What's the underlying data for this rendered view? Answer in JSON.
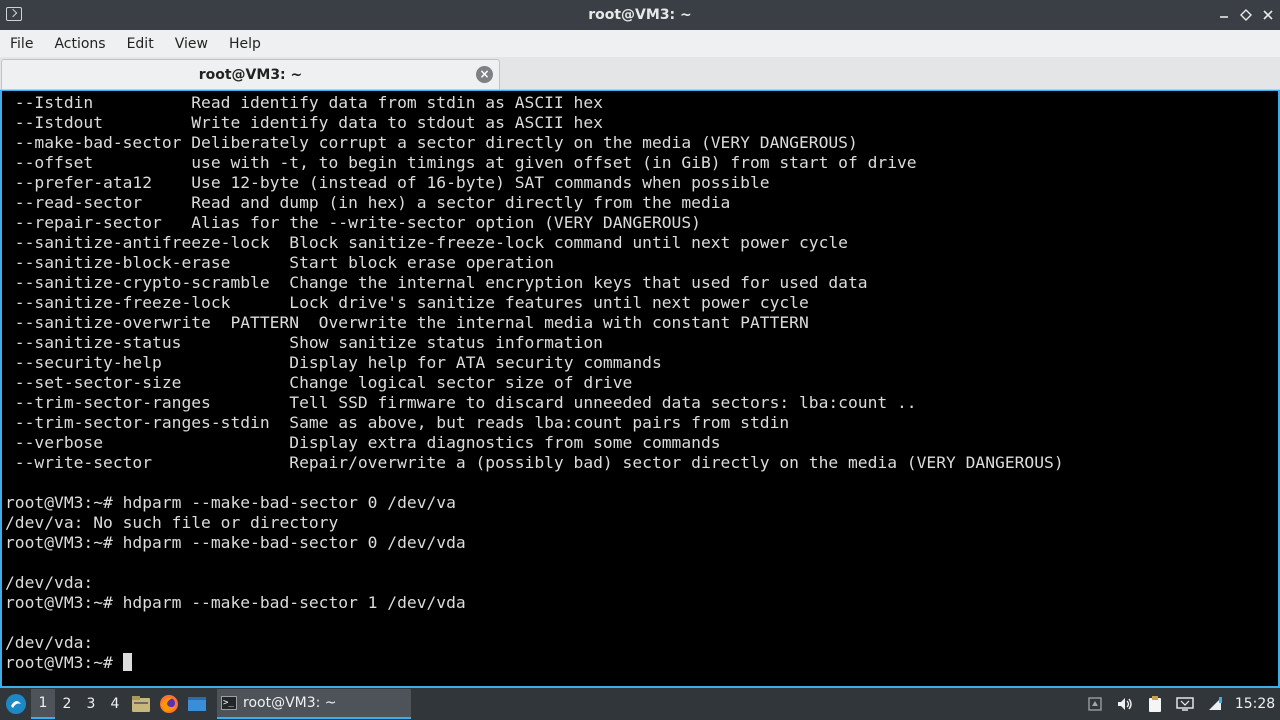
{
  "window": {
    "title": "root@VM3: ~",
    "controls": [
      "minimize-icon",
      "maximize-icon",
      "close-icon"
    ]
  },
  "menu": [
    "File",
    "Actions",
    "Edit",
    "View",
    "Help"
  ],
  "tab": {
    "label": "root@VM3: ~"
  },
  "terminal": {
    "lines": [
      " --Istdin          Read identify data from stdin as ASCII hex",
      " --Istdout         Write identify data to stdout as ASCII hex",
      " --make-bad-sector Deliberately corrupt a sector directly on the media (VERY DANGEROUS)",
      " --offset          use with -t, to begin timings at given offset (in GiB) from start of drive",
      " --prefer-ata12    Use 12-byte (instead of 16-byte) SAT commands when possible",
      " --read-sector     Read and dump (in hex) a sector directly from the media",
      " --repair-sector   Alias for the --write-sector option (VERY DANGEROUS)",
      " --sanitize-antifreeze-lock  Block sanitize-freeze-lock command until next power cycle",
      " --sanitize-block-erase      Start block erase operation",
      " --sanitize-crypto-scramble  Change the internal encryption keys that used for used data",
      " --sanitize-freeze-lock      Lock drive's sanitize features until next power cycle",
      " --sanitize-overwrite  PATTERN  Overwrite the internal media with constant PATTERN",
      " --sanitize-status           Show sanitize status information",
      " --security-help             Display help for ATA security commands",
      " --set-sector-size           Change logical sector size of drive",
      " --trim-sector-ranges        Tell SSD firmware to discard unneeded data sectors: lba:count ..",
      " --trim-sector-ranges-stdin  Same as above, but reads lba:count pairs from stdin",
      " --verbose                   Display extra diagnostics from some commands",
      " --write-sector              Repair/overwrite a (possibly bad) sector directly on the media (VERY DANGEROUS)",
      "",
      "root@VM3:~# hdparm --make-bad-sector 0 /dev/va",
      "/dev/va: No such file or directory",
      "root@VM3:~# hdparm --make-bad-sector 0 /dev/vda",
      "",
      "/dev/vda:",
      "root@VM3:~# hdparm --make-bad-sector 1 /dev/vda",
      "",
      "/dev/vda:"
    ],
    "prompt": "root@VM3:~# "
  },
  "taskbar": {
    "desktops": [
      "1",
      "2",
      "3",
      "4"
    ],
    "active_desktop": "1",
    "launchers": [
      "file-manager-icon",
      "firefox-icon",
      "desktop-icon"
    ],
    "task_label": "root@VM3: ~",
    "tray": [
      "notifications-icon",
      "volume-icon",
      "clipboard-icon",
      "display-icon",
      "network-icon"
    ],
    "clock": "15:28"
  },
  "colors": {
    "accent": "#3daee9",
    "taskbar_bg": "#31363b",
    "titlebar_bg": "#3a3f45",
    "terminal_fg": "#dcdcdc"
  }
}
